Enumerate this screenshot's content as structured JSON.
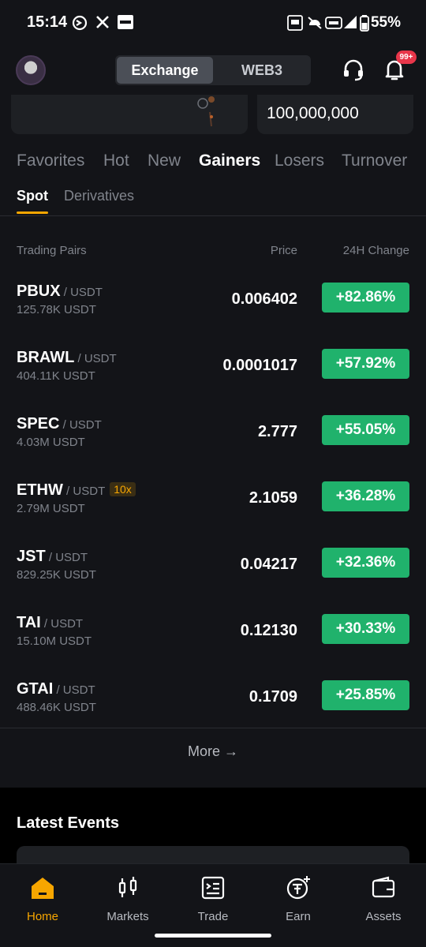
{
  "status_bar": {
    "time": "15:14",
    "battery": "55%"
  },
  "header": {
    "segments": [
      "Exchange",
      "WEB3"
    ],
    "notification_badge": "99+"
  },
  "cards": {
    "right_value": "100,000,000"
  },
  "tabs": [
    "Favorites",
    "Hot",
    "New",
    "Gainers",
    "Losers",
    "Turnover"
  ],
  "subtabs": [
    "Spot",
    "Derivatives"
  ],
  "columns": {
    "pairs": "Trading Pairs",
    "price": "Price",
    "change": "24H Change"
  },
  "rows": [
    {
      "base": "PBUX",
      "quote": " / USDT",
      "lev": "",
      "volume": "125.78K USDT",
      "price": "0.006402",
      "change": "+82.86%"
    },
    {
      "base": "BRAWL",
      "quote": " / USDT",
      "lev": "",
      "volume": "404.11K USDT",
      "price": "0.0001017",
      "change": "+57.92%"
    },
    {
      "base": "SPEC",
      "quote": " / USDT",
      "lev": "",
      "volume": "4.03M USDT",
      "price": "2.777",
      "change": "+55.05%"
    },
    {
      "base": "ETHW",
      "quote": " / USDT",
      "lev": "10x",
      "volume": "2.79M USDT",
      "price": "2.1059",
      "change": "+36.28%"
    },
    {
      "base": "JST",
      "quote": " / USDT",
      "lev": "",
      "volume": "829.25K USDT",
      "price": "0.04217",
      "change": "+32.36%"
    },
    {
      "base": "TAI",
      "quote": " / USDT",
      "lev": "",
      "volume": "15.10M USDT",
      "price": "0.12130",
      "change": "+30.33%"
    },
    {
      "base": "GTAI",
      "quote": " / USDT",
      "lev": "",
      "volume": "488.46K USDT",
      "price": "0.1709",
      "change": "+25.85%"
    }
  ],
  "more_label": "More →",
  "events": {
    "title": "Latest Events"
  },
  "nav": [
    {
      "label": "Home",
      "icon": "home-icon"
    },
    {
      "label": "Markets",
      "icon": "markets-icon"
    },
    {
      "label": "Trade",
      "icon": "trade-icon"
    },
    {
      "label": "Earn",
      "icon": "earn-icon"
    },
    {
      "label": "Assets",
      "icon": "wallet-icon"
    }
  ],
  "colors": {
    "accent": "#f7a600",
    "gain": "#20b26c",
    "badge": "#e8364a"
  }
}
